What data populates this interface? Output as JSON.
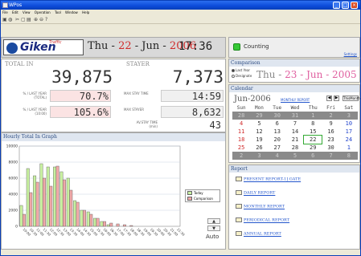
{
  "window": {
    "title": "WPos"
  },
  "menu": [
    "File",
    "Edit",
    "View",
    "Operation",
    "Tool",
    "Window",
    "Help"
  ],
  "toolbar_icons": [
    "open-icon",
    "print-icon",
    "cut-icon",
    "copy-icon",
    "paste-icon",
    "zoom-in-icon",
    "zoom-out-icon",
    "help-icon"
  ],
  "header": {
    "logo_text": "Giken",
    "logo_sub": "Traffic",
    "date_dow": "Thu - ",
    "date_day": "22",
    "date_sep1": "- Jun -",
    "date_year": "2006",
    "time": "17:36"
  },
  "status": {
    "label": "Counting",
    "settings_link": "Settings",
    "indicator_color": "#36c836"
  },
  "stats": {
    "total_in_label": "TOTAL IN",
    "total_in": "39,875",
    "stayer_label": "STAYER",
    "stayer": "7,373",
    "ly_total_label": "% / LAST YEAR\n(TOTAL)",
    "ly_total": "70.7%",
    "ly_10_label": "% / LAST YEAR\n(10:00)",
    "ly_10": "105.6%",
    "max_stay_time_label": "MAX STAY TIME",
    "max_stay_time": "14:59",
    "max_stayer_label": "MAX STAYER",
    "max_stayer": "8,632",
    "av_stay_time_label": "AV.STAY TIME\n(min)",
    "av_stay_time": "43"
  },
  "comparison": {
    "title": "Comparison",
    "opt_last_year": "Last Year",
    "opt_designate": "Designate",
    "date_prefix": "Thu - ",
    "date_text": "23 - Jun - 2005"
  },
  "calendar": {
    "title": "Calendar",
    "month_label": "Jun-2006",
    "monthly_report_link": "MONTHLY REPORT",
    "this_month_btn": "ThisMonth",
    "prev_btn": "◀",
    "next_btn": "▶",
    "weekdays": [
      "Sun",
      "Mon",
      "Tue",
      "Wed",
      "Thu",
      "Fri",
      "Sat"
    ],
    "weeks": [
      [
        "28",
        "29",
        "30",
        "31",
        "1",
        "2",
        "3"
      ],
      [
        "4",
        "5",
        "6",
        "7",
        "8",
        "9",
        "10"
      ],
      [
        "11",
        "12",
        "13",
        "14",
        "15",
        "16",
        "17"
      ],
      [
        "18",
        "19",
        "20",
        "21",
        "22",
        "23",
        "24"
      ],
      [
        "25",
        "26",
        "27",
        "28",
        "29",
        "30",
        "1"
      ],
      [
        "2",
        "3",
        "4",
        "5",
        "6",
        "7",
        "8"
      ]
    ],
    "today": "22"
  },
  "report": {
    "title": "Report",
    "items": [
      "PRESENT REPORT-1] GATE",
      "DAILY REPORT",
      "MONTHLY REPORT",
      "PERIODICAL REPORT",
      "ANNUAL REPORT"
    ]
  },
  "graph": {
    "title": "Hourly Total In Graph",
    "auto_label": "Auto",
    "scroll_up": "▲",
    "scroll_down": "▼"
  },
  "chart_data": {
    "type": "bar",
    "title": "Hourly Total In Graph",
    "xlabel": "",
    "ylabel": "",
    "ylim": [
      0,
      10000
    ],
    "yticks": [
      0,
      2000,
      4000,
      6000,
      8000,
      10000
    ],
    "categories": [
      "10:00",
      "10:30",
      "11:00",
      "11:30",
      "12:00",
      "12:30",
      "13:00",
      "13:30",
      "14:00",
      "14:30",
      "15:00",
      "15:30",
      "16:00",
      "16:30",
      "17:00",
      "17:30",
      "18:00",
      "18:30",
      "19:00",
      "19:30",
      "20:00",
      "20:30",
      "21:00",
      "21:30"
    ],
    "series": [
      {
        "name": "Today",
        "color": "#c8f0a0",
        "values": [
          2600,
          7200,
          6300,
          7800,
          7400,
          7400,
          6800,
          6000,
          3200,
          2000,
          1800,
          1000,
          600,
          200,
          0,
          0,
          0,
          0,
          0,
          0,
          0,
          0,
          0,
          0
        ]
      },
      {
        "name": "Comparison",
        "color": "#f0a8a8",
        "values": [
          1500,
          4200,
          5500,
          6000,
          5000,
          7500,
          5800,
          4500,
          3000,
          2000,
          1500,
          1000,
          600,
          400,
          300,
          200,
          100,
          0,
          0,
          0,
          0,
          0,
          0,
          0
        ]
      }
    ],
    "grid": true,
    "legend": "right"
  }
}
